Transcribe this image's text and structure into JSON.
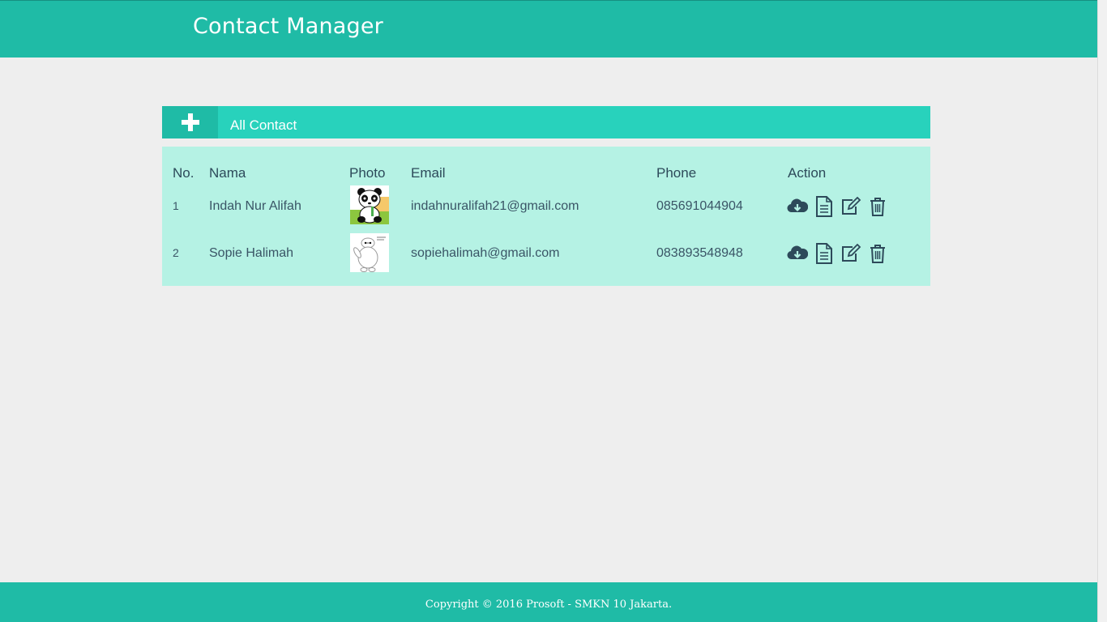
{
  "header": {
    "title": "Contact Manager"
  },
  "panel": {
    "add_icon": "plus-icon",
    "title": "All Contact"
  },
  "table": {
    "columns": [
      "No.",
      "Nama",
      "Photo",
      "Email",
      "Phone",
      "Action"
    ],
    "rows": [
      {
        "no": "1",
        "nama": "Indah Nur Alifah",
        "photo": "panda-avatar",
        "email": "indahnuralifah21@gmail.com",
        "phone": "085691044904"
      },
      {
        "no": "2",
        "nama": "Sopie Halimah",
        "photo": "baymax-avatar",
        "email": "sopiehalimah@gmail.com",
        "phone": "083893548948"
      }
    ],
    "action_icons": [
      "cloud-download-icon",
      "document-icon",
      "edit-icon",
      "trash-icon"
    ]
  },
  "footer": {
    "text": "Copyright © 2016 Prosoft - SMKN 10 Jakarta."
  },
  "colors": {
    "header": "#1fbba6",
    "panel_head": "#28d2bc",
    "table_bg": "#b5f2e4",
    "text": "#2d4a5a",
    "background": "#eeeeee"
  }
}
